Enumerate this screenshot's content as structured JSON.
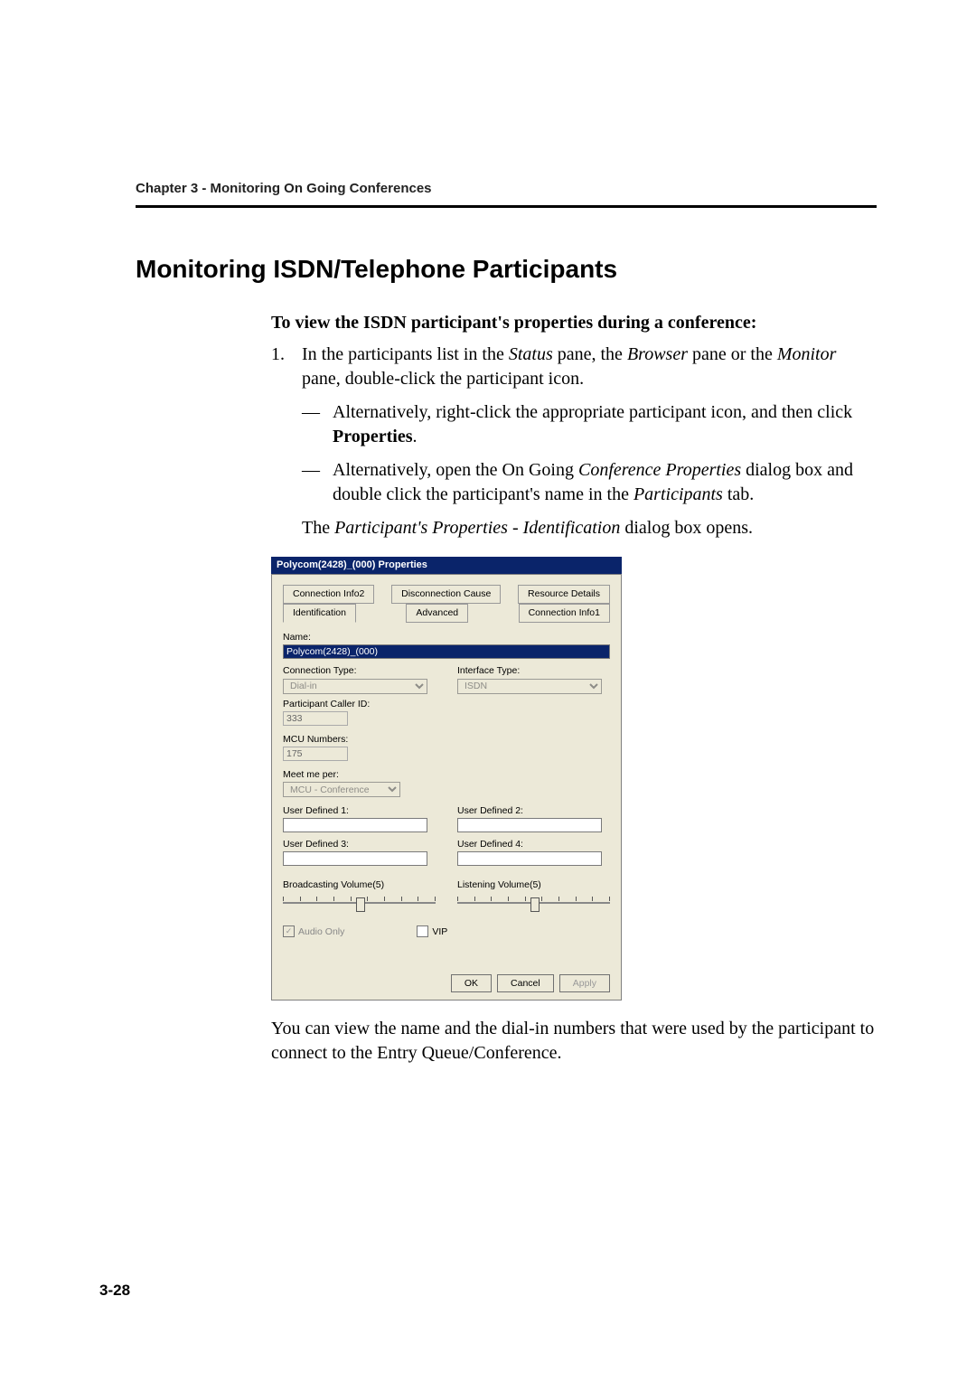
{
  "header": {
    "chapter": "Chapter 3 - Monitoring On Going Conferences"
  },
  "heading": "Monitoring ISDN/Telephone Participants",
  "content": {
    "subhead": "To view the ISDN participant's properties during a conference:",
    "step_num": "1.",
    "step_body_a": "In the participants list in the ",
    "step_body_b": " pane, the ",
    "step_body_c": " pane or the ",
    "step_body_d": " pane, double-click the participant icon.",
    "status_word": "Status",
    "browser_word": "Browser",
    "monitor_word": "Monitor",
    "dash": "—",
    "alt1_a": "Alternatively, right-click the appropriate participant icon, and then click ",
    "alt1_b": ".",
    "properties_word": "Properties",
    "alt2_a": "Alternatively, open the On Going ",
    "alt2_b": " dialog box and double click the participant's name in the ",
    "alt2_c": " tab.",
    "conf_props_word": "Conference Properties",
    "participants_word": "Participants",
    "opens_a": "The ",
    "opens_b": " dialog box opens.",
    "opens_em": "Participant's Properties - Identification",
    "footer": "You can view the name and the dial-in numbers that were used by the participant to connect to the Entry Queue/Conference."
  },
  "dialog": {
    "title": "Polycom(2428)_(000) Properties",
    "tabs_row1": {
      "a": "Connection Info2",
      "b": "Disconnection Cause",
      "c": "Resource Details"
    },
    "tabs_row2": {
      "a": "Identification",
      "b": "Advanced",
      "c": "Connection Info1"
    },
    "labels": {
      "name": "Name:",
      "conn_type": "Connection Type:",
      "iface_type": "Interface Type:",
      "caller_id": "Participant Caller ID:",
      "mcu_nums": "MCU Numbers:",
      "meet_me_per": "Meet me per:",
      "ud1": "User Defined 1:",
      "ud2": "User Defined 2:",
      "ud3": "User Defined 3:",
      "ud4": "User Defined 4:",
      "broadcast": "Broadcasting Volume(5)",
      "listen": "Listening Volume(5)",
      "audio_only": "Audio Only",
      "vip": "VIP"
    },
    "values": {
      "name": "Polycom(2428)_(000)",
      "conn_type": "Dial-in",
      "iface_type": "ISDN",
      "caller_id": "333",
      "mcu_nums": "175",
      "meet_me_per": "MCU - Conference"
    },
    "buttons": {
      "ok": "OK",
      "cancel": "Cancel",
      "apply": "Apply"
    }
  },
  "page_number": "3-28"
}
